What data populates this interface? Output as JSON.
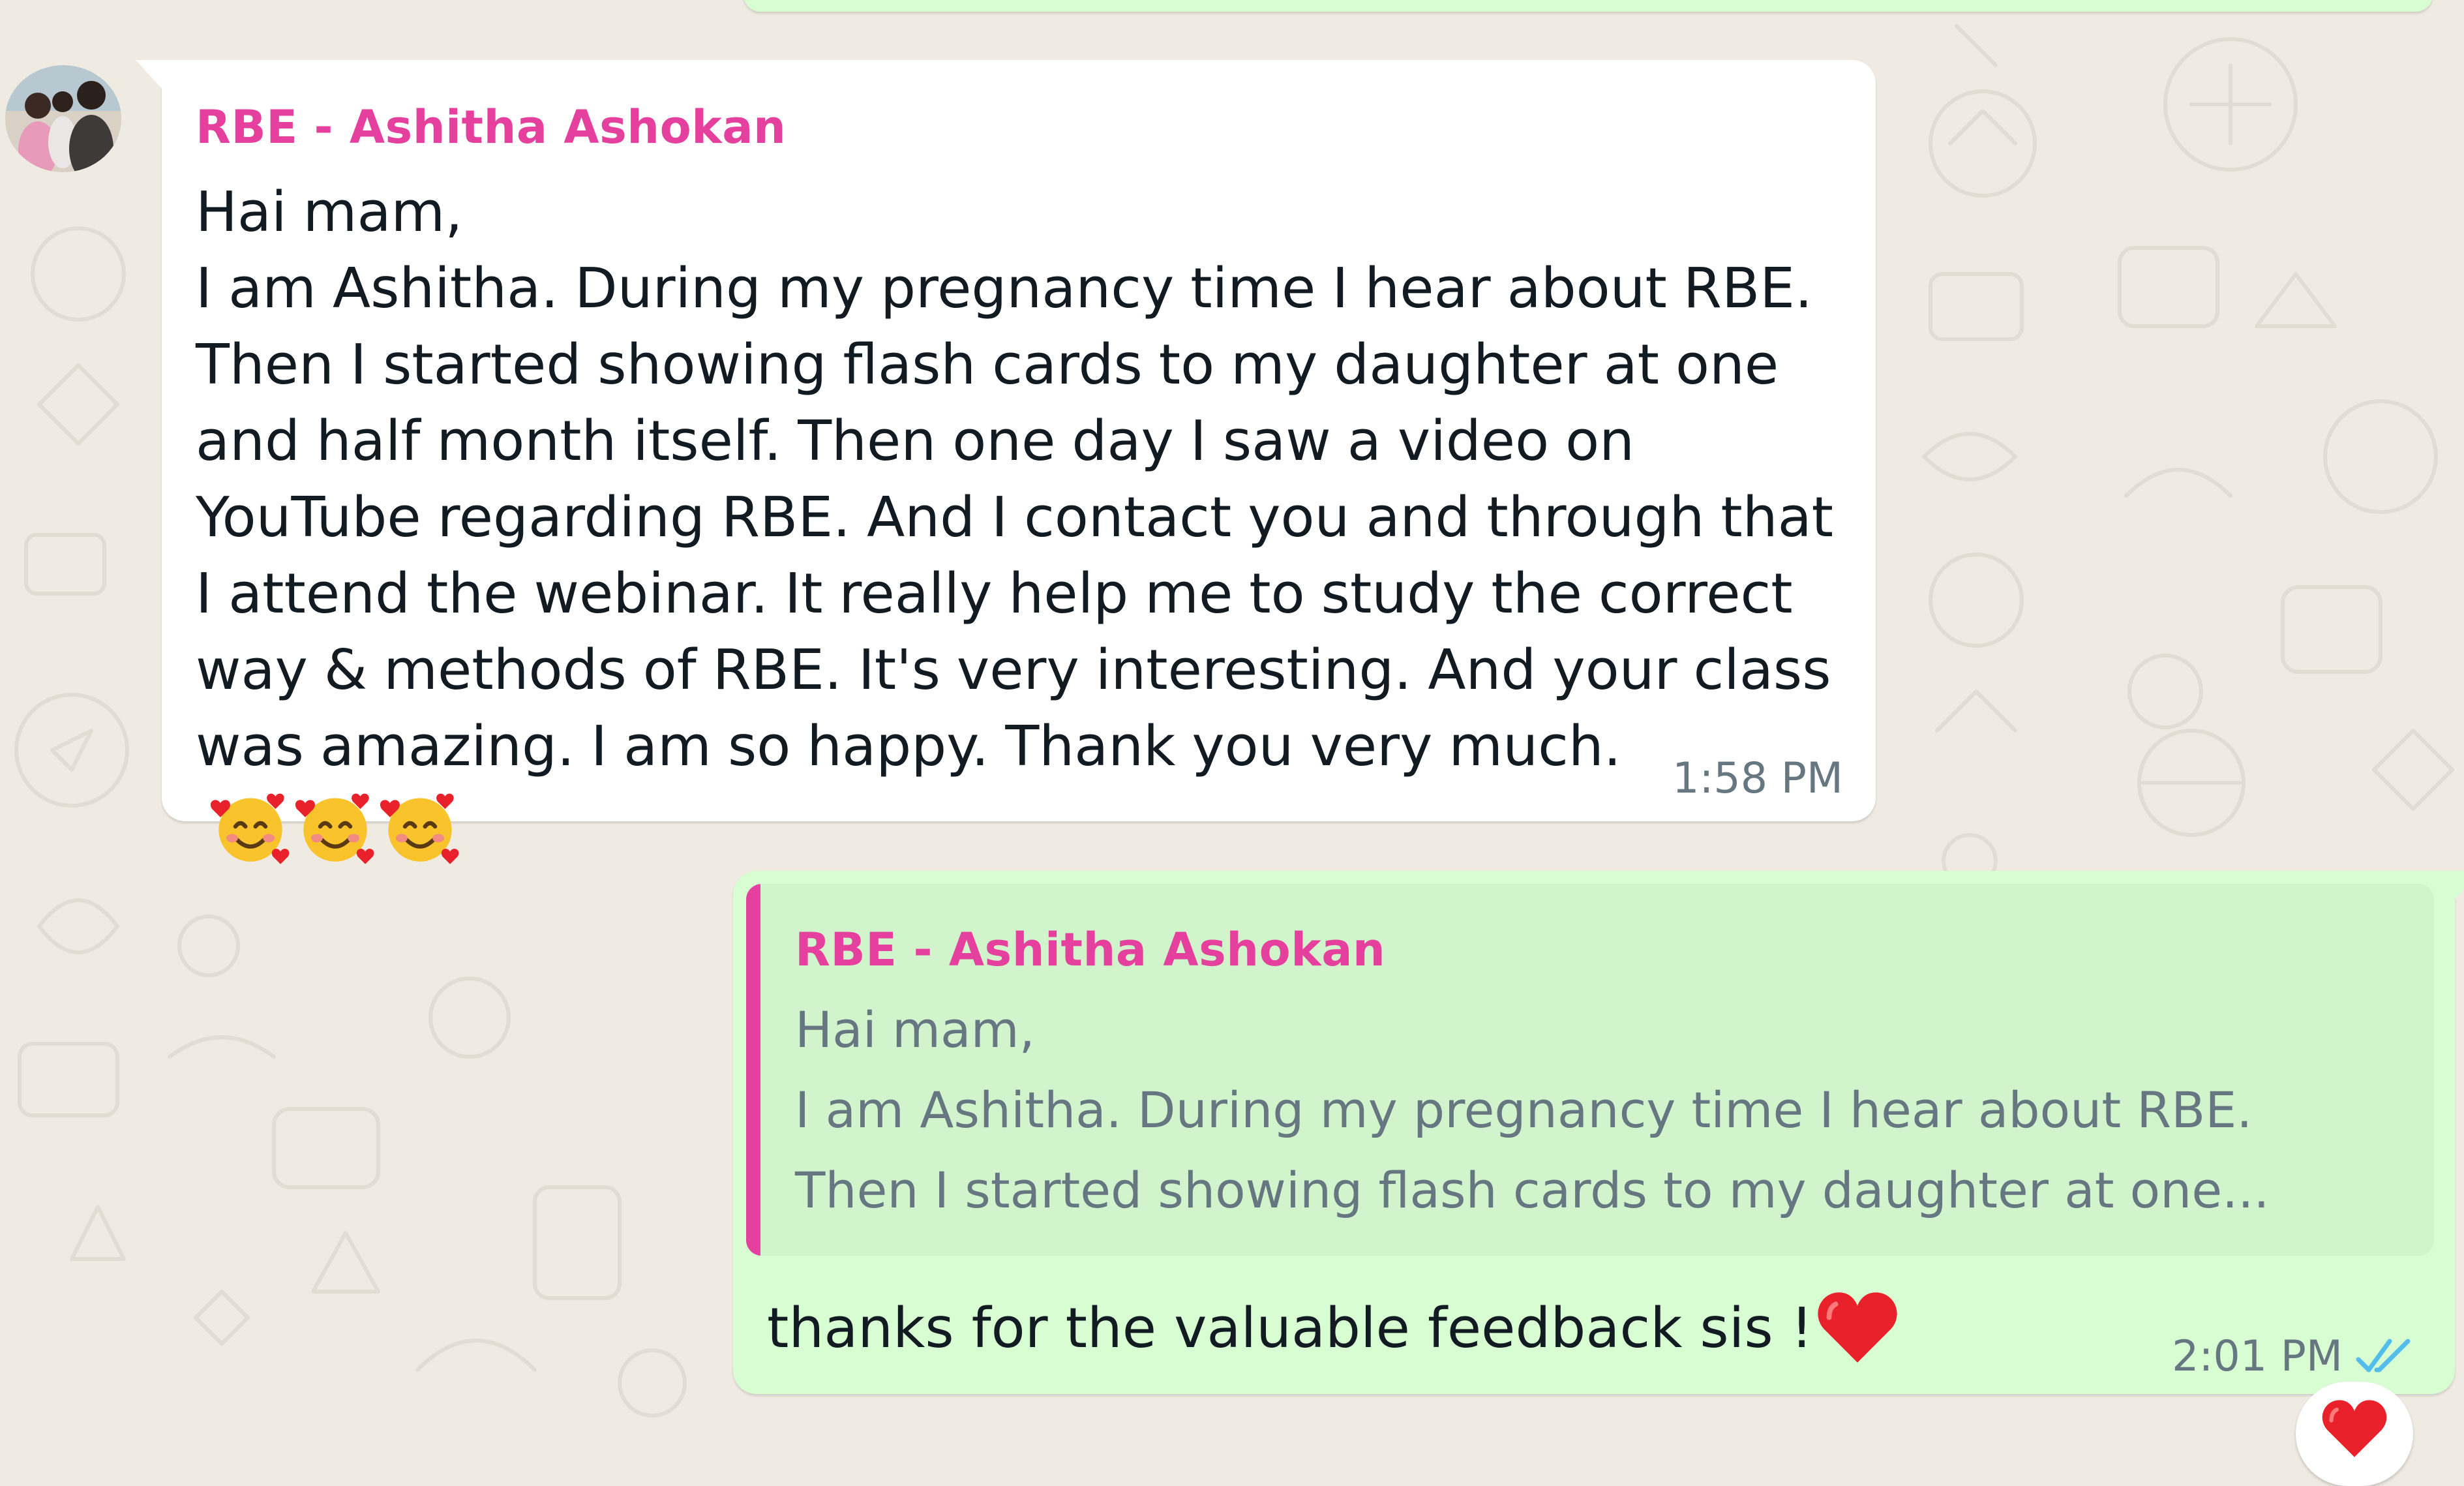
{
  "chat": {
    "incoming": {
      "sender": "RBE - Ashitha Ashokan",
      "text": "Hai mam,\nI am Ashitha. During my pregnancy time I hear about RBE. Then I started showing flash cards to my daughter at one and half month itself. Then one day I saw a video on YouTube regarding RBE. And I contact you and through that I attend the webinar. It really help me to study the correct way & methods of RBE. It's very interesting. And your class was amazing. I am so happy. Thank you very much.",
      "emojis": [
        "smiling-face-with-hearts",
        "smiling-face-with-hearts",
        "smiling-face-with-hearts"
      ],
      "time": "1:58 PM"
    },
    "outgoing": {
      "quoted_sender": "RBE - Ashitha Ashokan",
      "quoted_text": "Hai mam,\nI am Ashitha. During my pregnancy time I hear about RBE.\nThen I started showing flash cards to my daughter at one...",
      "text": "thanks for the valuable feedback sis !",
      "emoji": "red-heart",
      "time": "2:01 PM",
      "status_icon": "double-check-read-icon",
      "reaction": "red-heart"
    }
  },
  "colors": {
    "background": "#efeae2",
    "incoming_bubble": "#ffffff",
    "outgoing_bubble": "#d9fdd3",
    "quote_background": "#d1f4cc",
    "sender_name": "#e5409d",
    "message_text": "#111b21",
    "timestamp": "#667781",
    "read_ticks": "#53bdeb",
    "heart": "#e8212b"
  }
}
